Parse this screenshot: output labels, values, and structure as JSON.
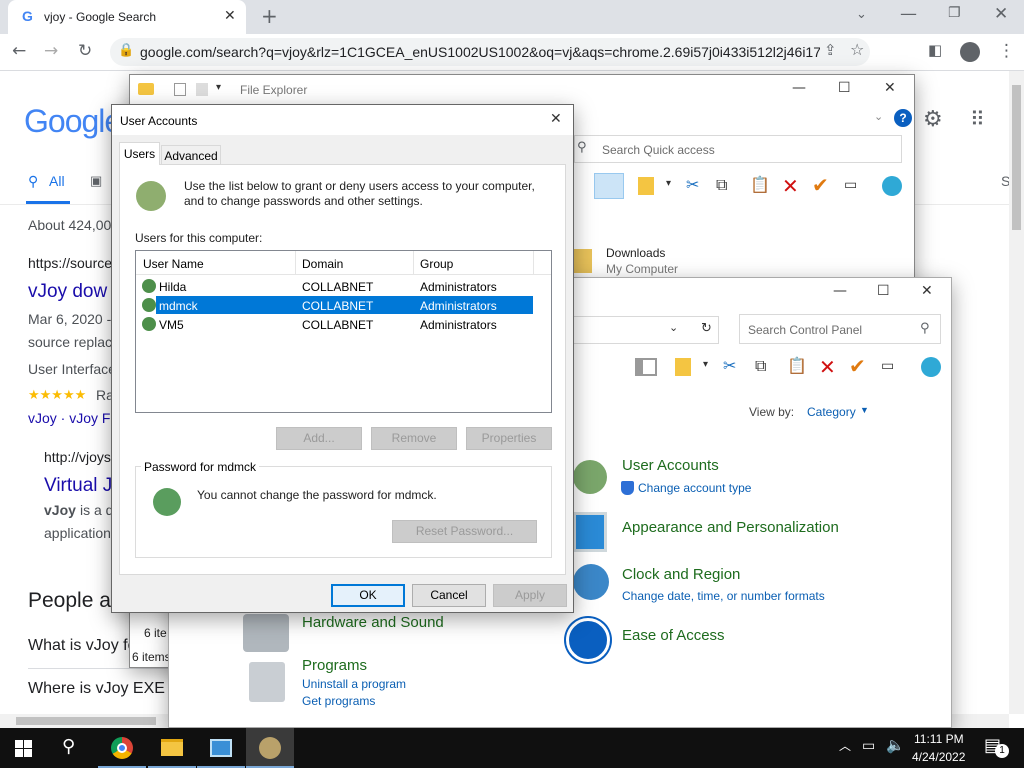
{
  "browser": {
    "tab_title": "vjoy - Google Search",
    "tab_favicon": "G",
    "url": "google.com/search?q=vjoy&rlz=1C1GCEA_enUS1002US1002&oq=vj&aqs=chrome.2.69i57j0i433i512l2j46i175i1..."
  },
  "google": {
    "logo": "Google",
    "tab_all": "All",
    "stats": "About 424,00",
    "r1_url": "https://source",
    "r1_title": "vJoy dow",
    "r1_date": "Mar 6, 2020 -",
    "r1_snip": "source replac",
    "r1_ui": "User Interface",
    "r1_rating": "Ra",
    "r1_links": "vJoy · vJoy F",
    "r2_url": "http://vjoys",
    "r2_title": "Virtual J",
    "r2_snip_bold": "vJoy",
    "r2_snip": "is a d",
    "r2_snip2": "application",
    "people": "People a",
    "q1": "What is vJoy fo",
    "q2": "Where is vJoy EXE",
    "right_s": "S"
  },
  "file_explorer": {
    "title": "File Explorer",
    "search_placeholder": "Search Quick access",
    "downloads": "Downloads",
    "downloads_sub": "My Computer",
    "items_count_1": "6 ite",
    "items_count_2": "6 items"
  },
  "control_panel": {
    "search_placeholder": "Search Control Panel",
    "view_by_label": "View by:",
    "view_by_value": "Category",
    "categories": [
      {
        "title": "User Accounts",
        "links": [
          "Change account type"
        ]
      },
      {
        "title": "Appearance and Personalization",
        "links": []
      },
      {
        "title": "Clock and Region",
        "links": [
          "Change date, time, or number formats"
        ]
      },
      {
        "title": "Ease of Access",
        "links": []
      },
      {
        "title": "Hardware and Sound",
        "links": []
      },
      {
        "title": "Programs",
        "links": [
          "Uninstall a program",
          "Get programs"
        ]
      }
    ]
  },
  "dialog": {
    "title": "User Accounts",
    "tabs": [
      "Users",
      "Advanced"
    ],
    "intro": "Use the list below to grant or deny users access to your computer, and to change passwords and other settings.",
    "users_label": "Users for this computer:",
    "columns": [
      "User Name",
      "Domain",
      "Group"
    ],
    "rows": [
      {
        "name": "Hilda",
        "domain": "COLLABNET",
        "group": "Administrators"
      },
      {
        "name": "mdmck",
        "domain": "COLLABNET",
        "group": "Administrators"
      },
      {
        "name": "VM5",
        "domain": "COLLABNET",
        "group": "Administrators"
      }
    ],
    "selected_row": 1,
    "add": "Add...",
    "remove": "Remove",
    "properties": "Properties",
    "password_group": "Password for mdmck",
    "password_msg": "You cannot change the password for mdmck.",
    "reset": "Reset Password...",
    "ok": "OK",
    "cancel": "Cancel",
    "apply": "Apply"
  },
  "taskbar": {
    "time": "11:11 PM",
    "date": "4/24/2022",
    "notification_count": "1"
  },
  "colors": {
    "selection": "#0078d7",
    "google_blue": "#4285f4",
    "cp_green": "#1e6c1e",
    "link": "#0b5fb3"
  }
}
